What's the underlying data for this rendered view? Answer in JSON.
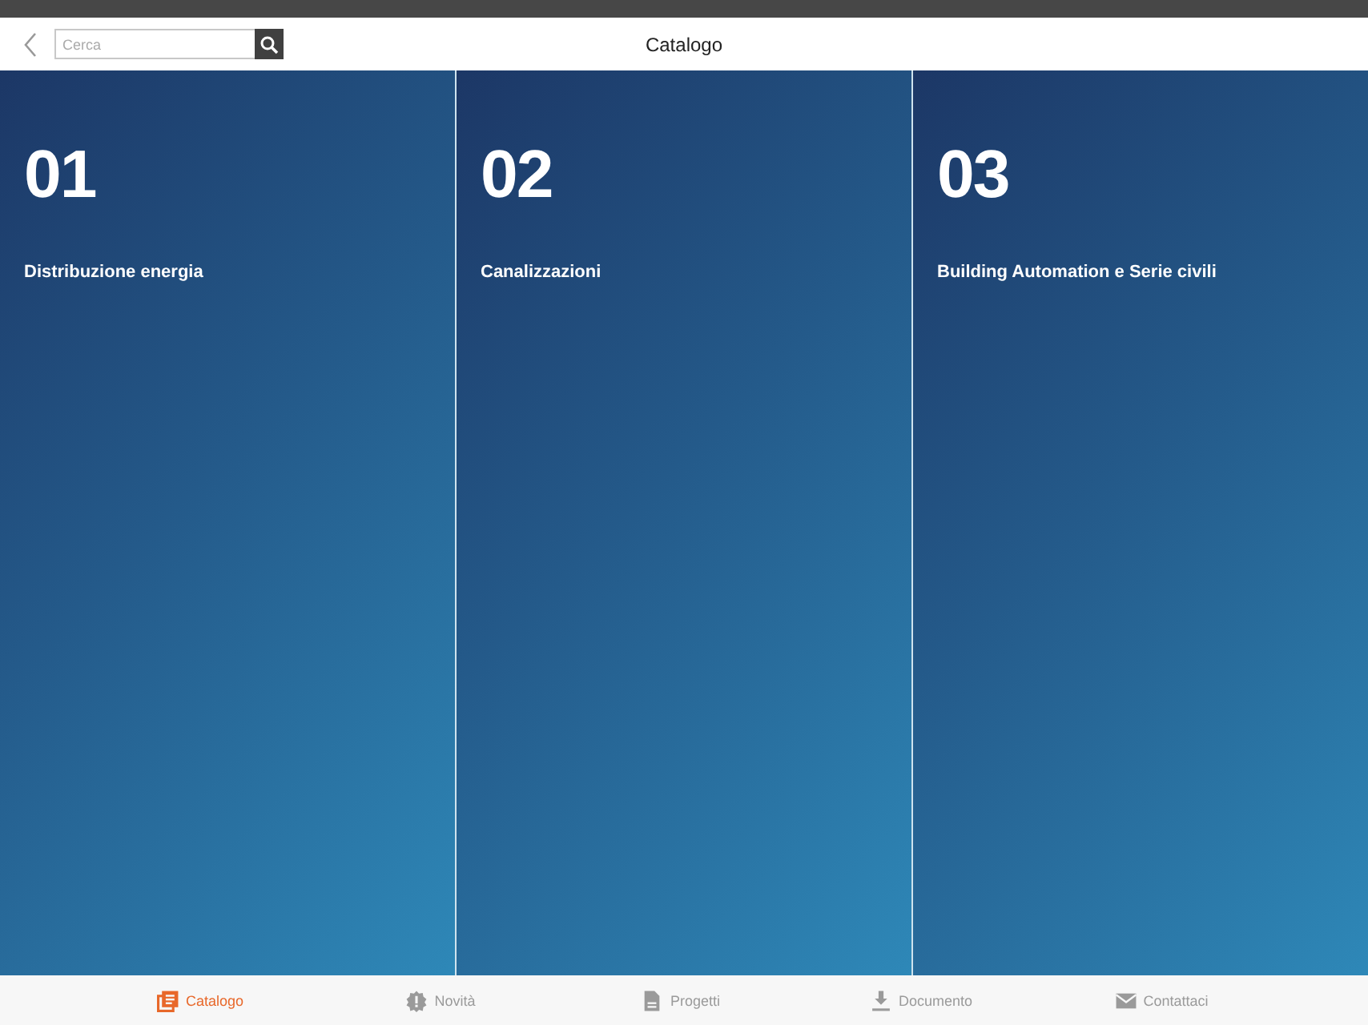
{
  "header": {
    "title": "Catalogo",
    "search": {
      "placeholder": "Cerca"
    }
  },
  "sections": [
    {
      "number": "01",
      "title": "Distribuzione energia"
    },
    {
      "number": "02",
      "title": "Canalizzazioni"
    },
    {
      "number": "03",
      "title": "Building Automation e Serie civili"
    }
  ],
  "tabs": [
    {
      "label": "Catalogo",
      "selected": true
    },
    {
      "label": "Novità",
      "selected": false
    },
    {
      "label": "Progetti",
      "selected": false
    },
    {
      "label": "Documento",
      "selected": false
    },
    {
      "label": "Contattaci",
      "selected": false
    }
  ]
}
